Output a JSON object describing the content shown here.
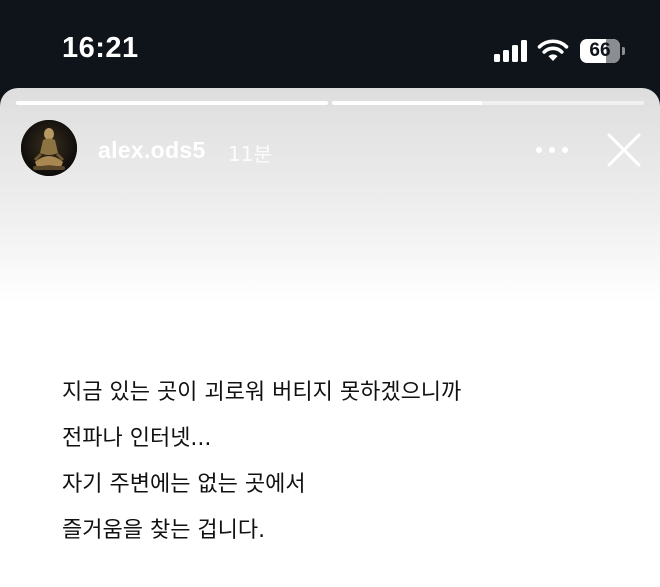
{
  "status_bar": {
    "time": "16:21",
    "icons": [
      "cellular-signal-icon",
      "wifi-icon",
      "battery-icon"
    ],
    "battery_level": "66",
    "battery_fraction": 0.66
  },
  "story": {
    "username": "alex.ods5",
    "time_ago": "11분",
    "progress": [
      1.0,
      0.48
    ],
    "icons": [
      "avatar-image",
      "more-icon",
      "close-icon"
    ],
    "lines": [
      "지금 있는 곳이 괴로워 버티지 못하겠으니까",
      "전파나 인터넷...",
      "자기 주변에는 없는 곳에서",
      "즐거움을 찾는 겁니다."
    ]
  },
  "colors": {
    "status_bar_bg": "#0f131a",
    "text": "#111111",
    "header_text": "#ffffff"
  }
}
